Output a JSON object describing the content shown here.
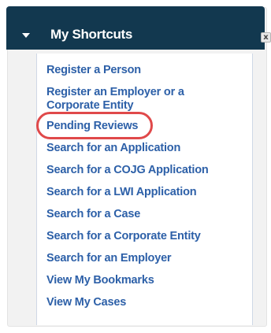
{
  "widget": {
    "title": "My Shortcuts",
    "close_glyph": "x",
    "collapse_icon": "caret-down-icon",
    "header_color": "#12384f",
    "link_color": "#2d60a8",
    "highlight_color": "#e0494a"
  },
  "shortcuts": [
    {
      "label": "Register a Person"
    },
    {
      "label": "Register an Employer or a Corporate Entity"
    },
    {
      "label": "Pending Reviews",
      "highlighted": true
    },
    {
      "label": "Search for an Application"
    },
    {
      "label": "Search for a COJG Application"
    },
    {
      "label": "Search for a LWI Application"
    },
    {
      "label": "Search for a Case"
    },
    {
      "label": "Search for a Corporate Entity"
    },
    {
      "label": "Search for an Employer"
    },
    {
      "label": "View My Bookmarks"
    },
    {
      "label": "View My Cases"
    }
  ]
}
